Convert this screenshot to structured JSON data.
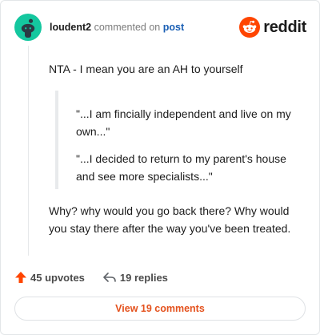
{
  "header": {
    "username": "loudent2",
    "action": "commented on",
    "post_link": "post",
    "brand_name": "reddit"
  },
  "comment": {
    "line1": "NTA - I mean you are an AH to yourself",
    "quotes": [
      "\"...I am fincially independent and live on my own...\"",
      "\"...I decided to return to my parent's house and see more specialists...\""
    ],
    "line2": "Why? why would you go back there? Why would you stay there after the way you've been treated."
  },
  "stats": {
    "upvotes": "45 upvotes",
    "replies": "19 replies"
  },
  "view_button": "View 19 comments",
  "icons": {
    "avatar": "snoo-avatar-icon",
    "brand": "reddit-logo-icon",
    "upvote": "upvote-arrow-icon",
    "reply": "reply-arrow-icon"
  },
  "colors": {
    "accent": "#ff4500",
    "link": "#1a5fb4",
    "avatar_bg": "#14c79f",
    "button_text": "#e4521e"
  }
}
